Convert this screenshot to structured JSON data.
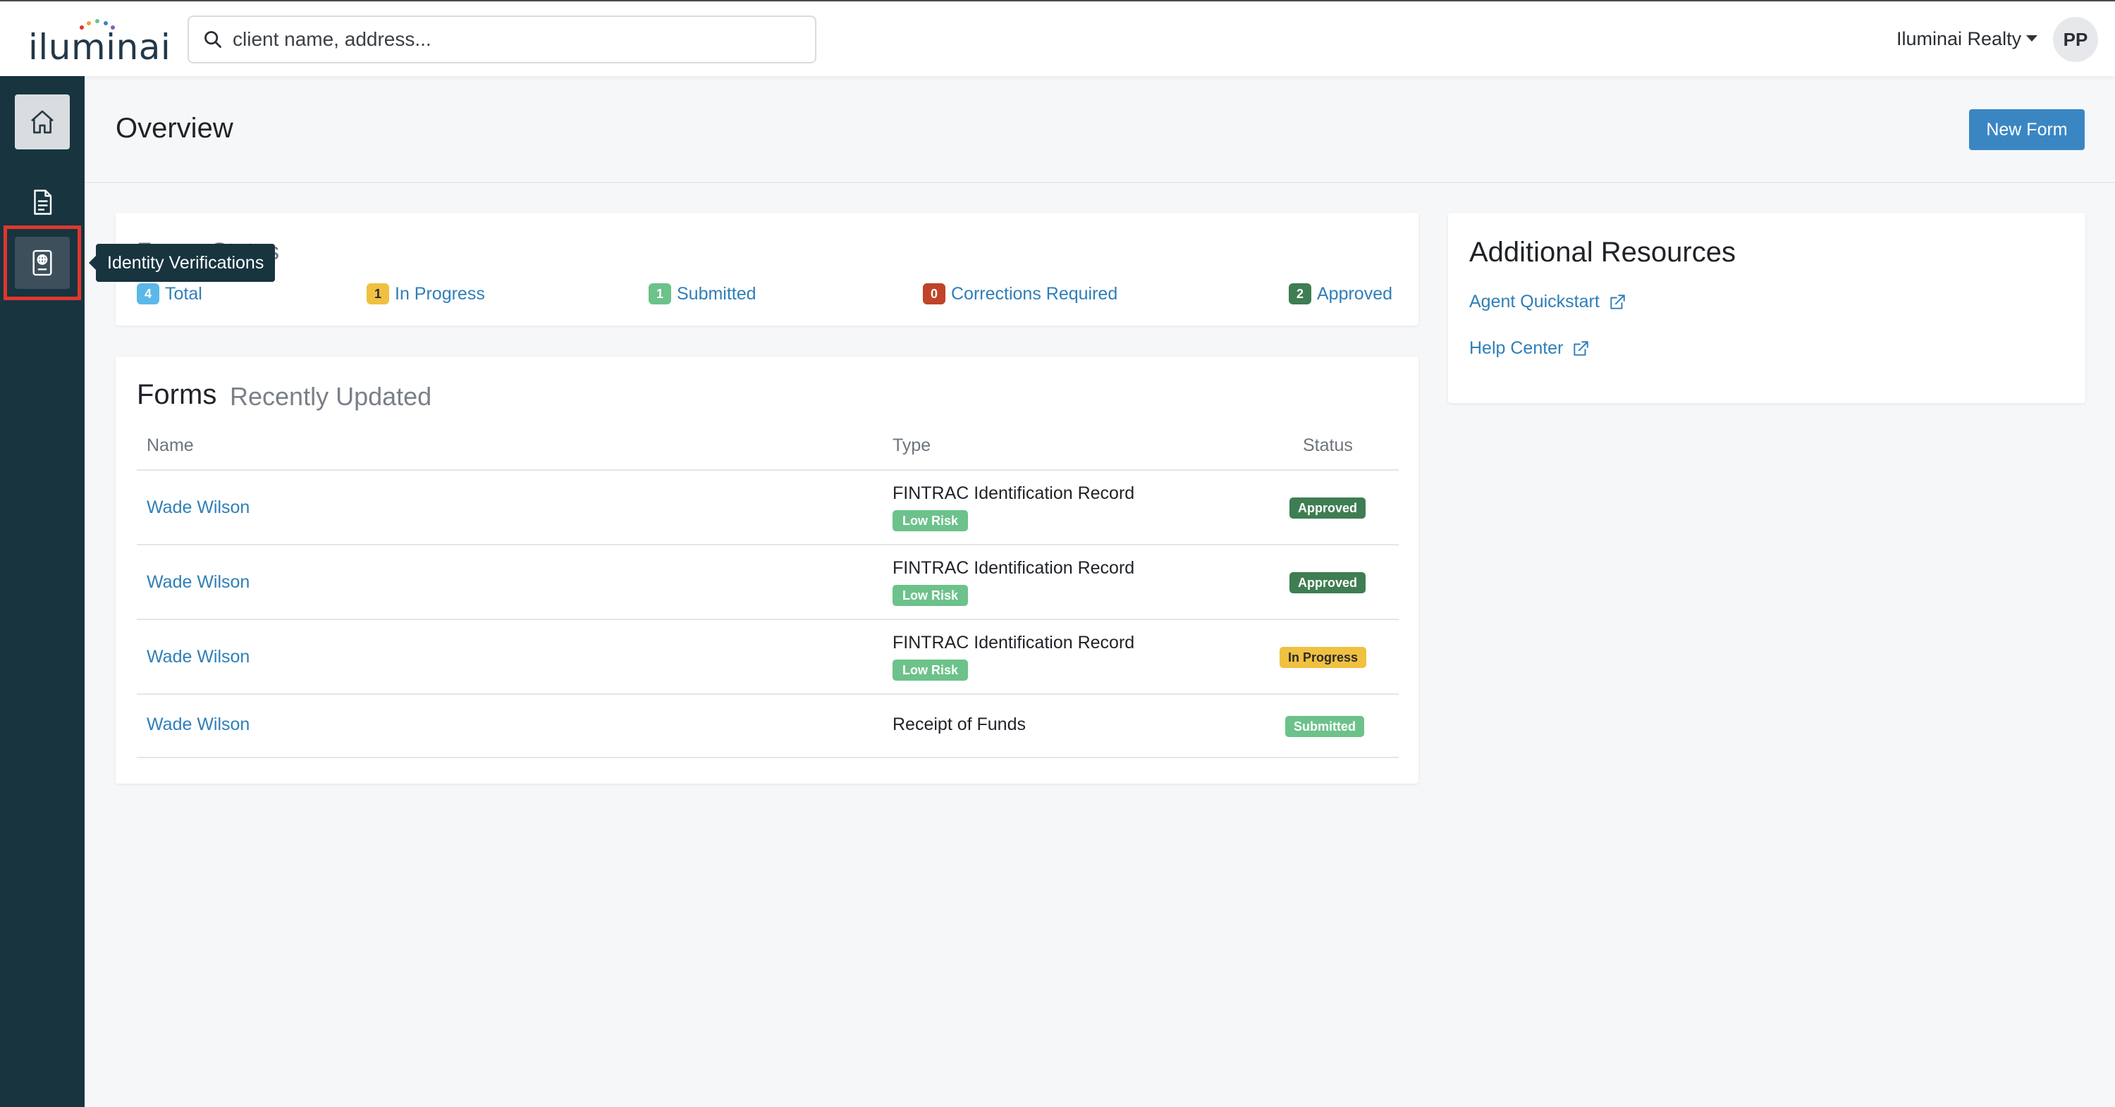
{
  "brand": {
    "logo_text": "iluminai"
  },
  "search": {
    "placeholder": "client name, address..."
  },
  "account": {
    "org_name": "Iluminai Realty",
    "avatar_initials": "PP"
  },
  "sidebar": {
    "items": [
      {
        "name": "home",
        "icon": "home-icon"
      },
      {
        "name": "forms",
        "icon": "document-icon"
      },
      {
        "name": "identity-verifications",
        "icon": "id-card-icon",
        "active": true
      }
    ],
    "tooltip": "Identity Verifications"
  },
  "header": {
    "title": "Overview",
    "new_form_label": "New Form"
  },
  "status_card": {
    "title": "Forms Status",
    "stats": [
      {
        "label": "Total",
        "count": "4",
        "color": "#5bb8e8"
      },
      {
        "label": "In Progress",
        "count": "1",
        "color": "#f0c040"
      },
      {
        "label": "Submitted",
        "count": "1",
        "color": "#6cc28a"
      },
      {
        "label": "Corrections Required",
        "count": "0",
        "color": "#c0432a"
      },
      {
        "label": "Approved",
        "count": "2",
        "color": "#3f7d52"
      }
    ]
  },
  "forms_card": {
    "title": "Forms",
    "subtitle": "Recently Updated",
    "columns": [
      "Name",
      "Type",
      "Status"
    ],
    "rows": [
      {
        "name": "Wade Wilson",
        "type": "FINTRAC Identification Record",
        "risk": "Low Risk",
        "status": "Approved"
      },
      {
        "name": "Wade Wilson",
        "type": "FINTRAC Identification Record",
        "risk": "Low Risk",
        "status": "Approved"
      },
      {
        "name": "Wade Wilson",
        "type": "FINTRAC Identification Record",
        "risk": "Low Risk",
        "status": "In Progress"
      },
      {
        "name": "Wade Wilson",
        "type": "Receipt of Funds",
        "risk": "",
        "status": "Submitted"
      }
    ]
  },
  "resources_card": {
    "title": "Additional Resources",
    "links": [
      {
        "label": "Agent Quickstart",
        "icon": "external-link-icon"
      },
      {
        "label": "Help Center",
        "icon": "external-link-icon"
      }
    ]
  },
  "colors": {
    "sidebar": "#17343f",
    "primary": "#3a86c3",
    "link": "#2f7fb8",
    "approved": "#3f7d52",
    "in_progress": "#f0c040",
    "submitted": "#6cc28a",
    "low_risk": "#6cc28a",
    "highlight": "#e0372e"
  }
}
